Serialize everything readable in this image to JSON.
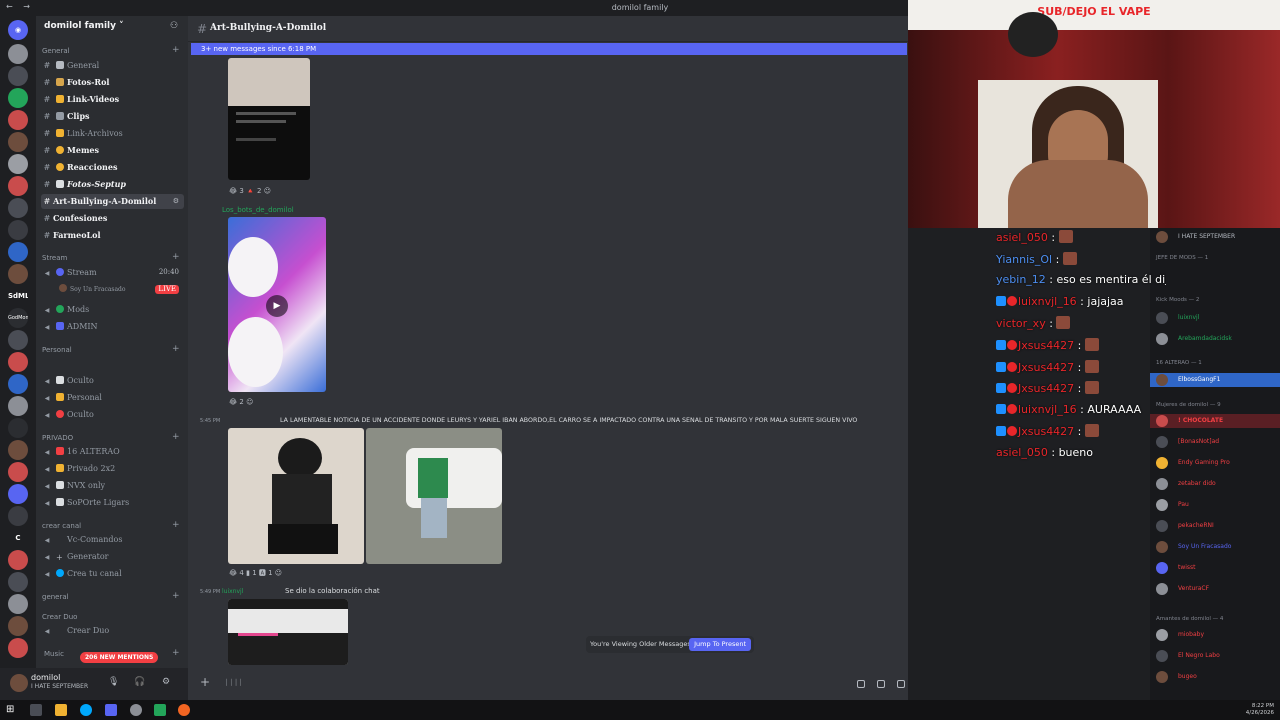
{
  "window": {
    "title": "domilol family",
    "nav": "← →"
  },
  "server_list": {
    "labels": [
      "SdML",
      "GodMom",
      "C"
    ],
    "badge": "206 NEW MENTIONS"
  },
  "guild": {
    "name": "domilol family ˅"
  },
  "categories": [
    {
      "label": "General"
    },
    {
      "label": "Stream"
    },
    {
      "label": "Personal"
    },
    {
      "label": "PRIVADO"
    },
    {
      "label": "crear canal"
    },
    {
      "label": "general"
    },
    {
      "label": "Crear Duo"
    },
    {
      "label": "Music"
    }
  ],
  "channels": [
    {
      "prefix": "#",
      "label": "General",
      "emoji_color": "#b5bac1"
    },
    {
      "prefix": "#",
      "label": "Fotos-Rol",
      "emoji_color": "#d6a54c"
    },
    {
      "prefix": "#",
      "label": "Link-Videos",
      "emoji_color": "#f0b232"
    },
    {
      "prefix": "#",
      "label": "Clips",
      "emoji_color": "#949ba4"
    },
    {
      "prefix": "#",
      "label": "Memes",
      "emoji_color": "#f0b232"
    },
    {
      "prefix": "#",
      "label": "Reacciones",
      "emoji_color": "#f0b232"
    },
    {
      "prefix": "#",
      "label": "Link-Archivos",
      "emoji_color": "#f0b232"
    },
    {
      "prefix": "#",
      "label": "Fotos-Septup",
      "emoji_color": "#dbdee1"
    },
    {
      "prefix": "#",
      "label": "Art-Bullying-A-Domilol",
      "emoji_color": "#dbdee1"
    },
    {
      "prefix": "#",
      "label": "Confesiones",
      "emoji_color": ""
    },
    {
      "prefix": "#",
      "label": "FarmeoLol",
      "emoji_color": ""
    },
    {
      "prefix": "🔊",
      "label": "Stream",
      "emoji_color": "#5865f2",
      "right": "20:40"
    },
    {
      "prefix": "",
      "label": "Soy Un Fracasado",
      "emoji_color": "",
      "right": "LIVE"
    },
    {
      "prefix": "🔊",
      "label": "Mods",
      "emoji_color": "#23a55a"
    },
    {
      "prefix": "🔊",
      "label": "ADMIN",
      "emoji_color": "#5865f2"
    },
    {
      "prefix": "🔊",
      "label": "Oculto",
      "emoji_color": "#dbdee1"
    },
    {
      "prefix": "🔊",
      "label": "Personal",
      "emoji_color": "#f0b232"
    },
    {
      "prefix": "🔊",
      "label": "Oculto",
      "emoji_color": "#f23f43"
    },
    {
      "prefix": "🔊",
      "label": "16 ALTERAO",
      "emoji_color": "#f23f43"
    },
    {
      "prefix": "🔊",
      "label": "Privado 2x2",
      "emoji_color": "#f0b232"
    },
    {
      "prefix": "🔊",
      "label": "NVX only",
      "emoji_color": "#dbdee1"
    },
    {
      "prefix": "🔊",
      "label": "SoPOrte Ligars",
      "emoji_color": "#dbdee1"
    },
    {
      "prefix": "🔊",
      "label": "Vc-Comandos",
      "emoji_color": ""
    },
    {
      "prefix": "+",
      "label": "Generator",
      "emoji_color": ""
    },
    {
      "prefix": "🔊",
      "label": "Crea tu canal",
      "emoji_color": "#00a8fc"
    },
    {
      "prefix": "🔊",
      "label": "Crear Duo",
      "emoji_color": ""
    }
  ],
  "user": {
    "name": "domilol",
    "status": "I HATE SEPTEMBER"
  },
  "chat": {
    "channel_name": "Art-Bullying-A-Domilol",
    "new_messages": "3+ new messages since 6:18 PM",
    "bot_name": "Los_bots_de_domilol",
    "msg1_time": "5:45 PM",
    "msg1_text": "LA LAMENTABLE NOTICIA DE UN ACCIDENTE DONDE LEURYS Y YARIEL IBAN ABORDO,EL CARRO SE A IMPACTADO CONTRA UNA SEÑAL DE TRÁNSITO Y POR MALA SUERTE SIGUEN VIVO",
    "msg2_time": "5:49 PM",
    "msg2_author": "luixnvjl",
    "msg2_text": "Se dio la colaboración chat",
    "reactions_a": [
      "3",
      "2"
    ],
    "reactions_b": [
      "2"
    ],
    "reactions_c": [
      "4",
      "1",
      "1"
    ],
    "viewing_older": "You're Viewing Older Messages",
    "jump_label": "Jump To Present"
  },
  "stream": {
    "banner": "SUB/DEJO EL VAPE"
  },
  "stream_chat": [
    {
      "user": "asiel_050",
      "color": "#e8262a",
      "text": "",
      "emote": true
    },
    {
      "user": "Yiannis_Ol",
      "color": "#4d8ef0",
      "text": "",
      "emote": true
    },
    {
      "user": "yebin_12",
      "color": "#4d8ef0",
      "text": "eso es mentira él dijo que Na va salir",
      "emote": false
    },
    {
      "user": "luixnvjl_16",
      "color": "#e8262a",
      "text": "jajajaa",
      "emote": false,
      "badges": true
    },
    {
      "user": "victor_xy",
      "color": "#e8262a",
      "text": "",
      "emote": true
    },
    {
      "user": "Jxsus4427",
      "color": "#e8262a",
      "text": "",
      "emote": true,
      "badges": true
    },
    {
      "user": "Jxsus4427",
      "color": "#e8262a",
      "text": "",
      "emote": true,
      "badges": true
    },
    {
      "user": "Jxsus4427",
      "color": "#e8262a",
      "text": "",
      "emote": true,
      "badges": true
    },
    {
      "user": "luixnvjl_16",
      "color": "#e8262a",
      "text": "AURAAAA",
      "emote": false,
      "badges": true
    },
    {
      "user": "Jxsus4427",
      "color": "#e8262a",
      "text": "",
      "emote": true,
      "badges": true
    },
    {
      "user": "asiel_050",
      "color": "#e8262a",
      "text": "bueno",
      "emote": false
    }
  ],
  "member_overlay": {
    "top_status": "I HATE SEPTEMBER",
    "categories": [
      "JEFE DE MODS — 1",
      "Kick Moods — 2",
      "16 ALTERAO — 1",
      "Mujeres de domilol — 9",
      "Amantes de domilol — 4"
    ],
    "members": [
      {
        "name": "luixnvjl",
        "color": "#23a55a"
      },
      {
        "name": "Arebamdadacidsk",
        "color": "#23a55a"
      },
      {
        "name": "ElbossGangF1",
        "color": "#4d8ef0"
      },
      {
        "name": "! CHOCOLATE",
        "color": "#f23f43"
      },
      {
        "name": "[BonasNot]ad",
        "color": "#f23f43"
      },
      {
        "name": "Endy Gaming Pro",
        "color": "#f23f43"
      },
      {
        "name": "zetabar dido",
        "color": "#f23f43"
      },
      {
        "name": "Pau",
        "color": "#f23f43"
      },
      {
        "name": "pekacheRNI",
        "color": "#f23f43"
      },
      {
        "name": "Soy Un Fracasado",
        "color": "#f23f43"
      },
      {
        "name": "twisst",
        "color": "#f23f43"
      },
      {
        "name": "VenturaCF",
        "color": "#f23f43"
      },
      {
        "name": "miobaby",
        "color": "#f23f43"
      },
      {
        "name": "El Negro Labo",
        "color": "#f23f43"
      },
      {
        "name": "bugeo",
        "color": "#f23f43"
      }
    ]
  },
  "taskbar": {
    "time": "8:22 PM",
    "date": "4/26/2026"
  }
}
